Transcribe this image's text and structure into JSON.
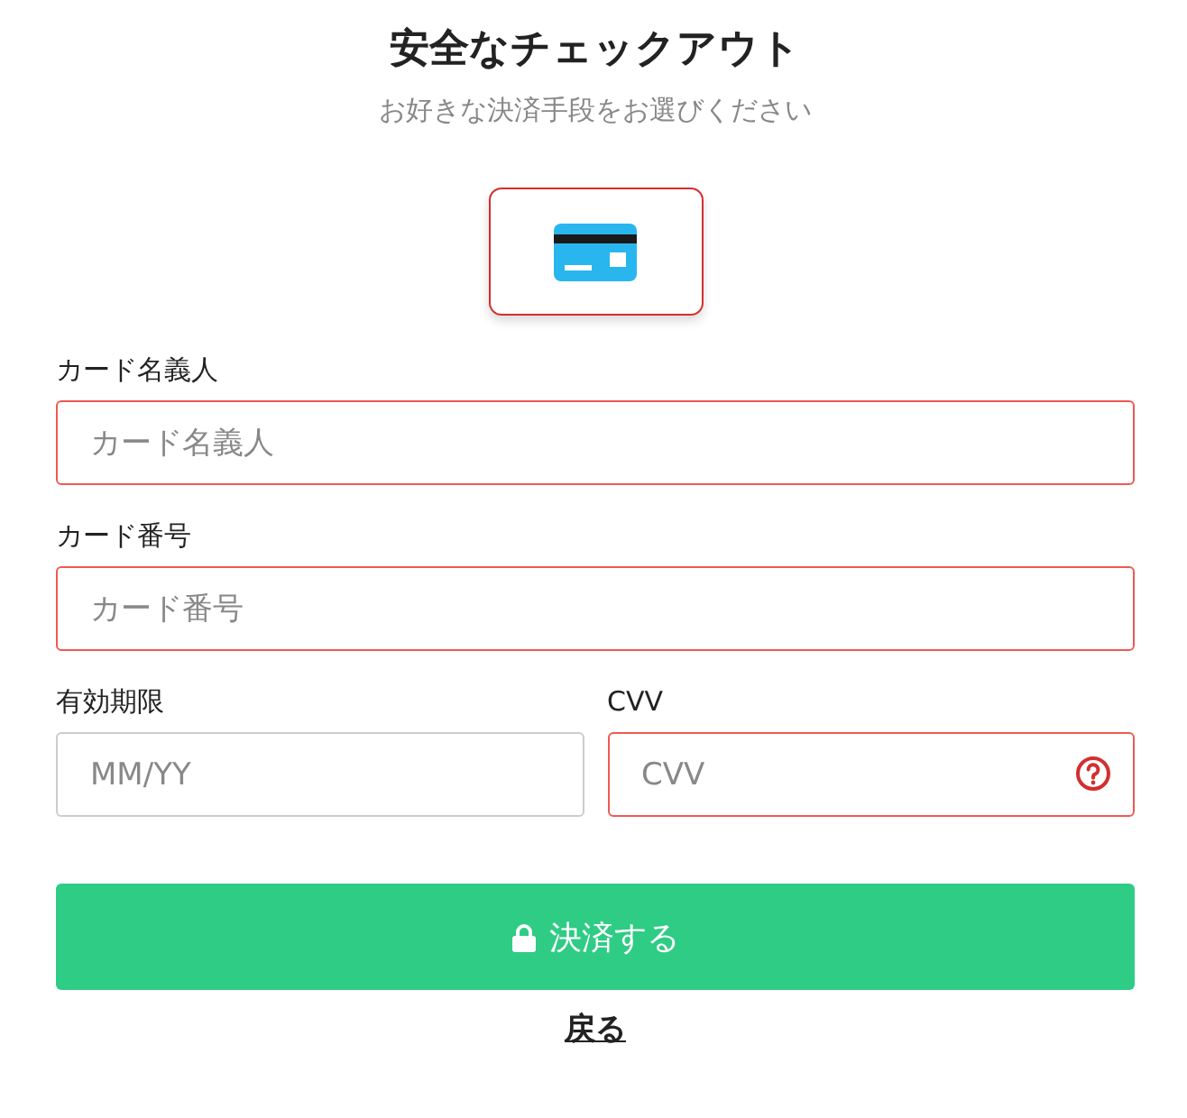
{
  "title": "安全なチェックアウト",
  "subtitle": "お好きな決済手段をお選びください",
  "payment_methods": [
    {
      "kind": "card",
      "selected": true
    }
  ],
  "fields": [
    {
      "label": "カード名義人",
      "placeholder": "カード名義人",
      "invalid": true
    },
    {
      "label": "カード番号",
      "placeholder": "カード番号",
      "invalid": true
    }
  ],
  "row_fields": [
    {
      "label": "有効期限",
      "placeholder": "MM/YY",
      "invalid": false,
      "help": false
    },
    {
      "label": "CVV",
      "placeholder": "CVV",
      "invalid": true,
      "help": true
    }
  ],
  "pay_button": {
    "label": "決済する"
  },
  "back_link": "戻る"
}
